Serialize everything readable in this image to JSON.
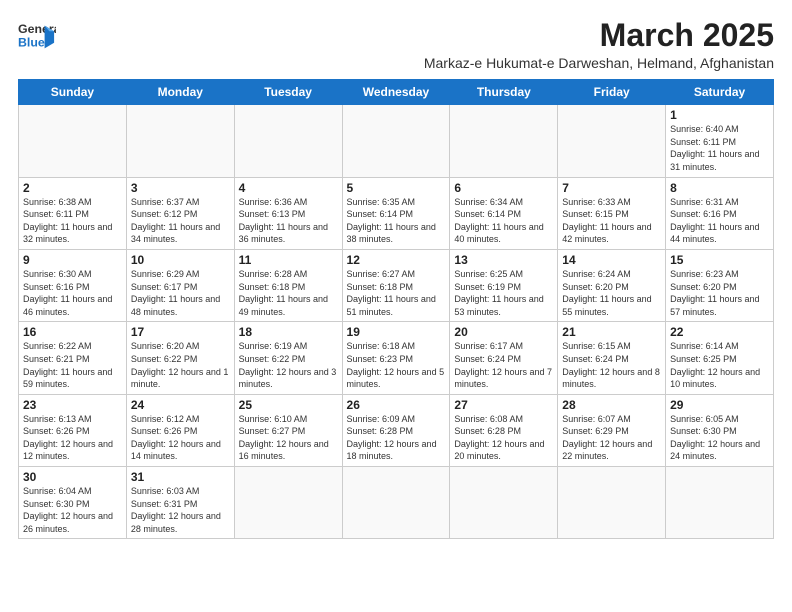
{
  "logo": {
    "line1": "General",
    "line2": "Blue"
  },
  "title": "March 2025",
  "subtitle": "Markaz-e Hukumat-e Darweshan, Helmand, Afghanistan",
  "weekdays": [
    "Sunday",
    "Monday",
    "Tuesday",
    "Wednesday",
    "Thursday",
    "Friday",
    "Saturday"
  ],
  "weeks": [
    [
      {
        "day": "",
        "info": ""
      },
      {
        "day": "",
        "info": ""
      },
      {
        "day": "",
        "info": ""
      },
      {
        "day": "",
        "info": ""
      },
      {
        "day": "",
        "info": ""
      },
      {
        "day": "",
        "info": ""
      },
      {
        "day": "1",
        "info": "Sunrise: 6:40 AM\nSunset: 6:11 PM\nDaylight: 11 hours and 31 minutes."
      }
    ],
    [
      {
        "day": "2",
        "info": "Sunrise: 6:38 AM\nSunset: 6:11 PM\nDaylight: 11 hours and 32 minutes."
      },
      {
        "day": "3",
        "info": "Sunrise: 6:37 AM\nSunset: 6:12 PM\nDaylight: 11 hours and 34 minutes."
      },
      {
        "day": "4",
        "info": "Sunrise: 6:36 AM\nSunset: 6:13 PM\nDaylight: 11 hours and 36 minutes."
      },
      {
        "day": "5",
        "info": "Sunrise: 6:35 AM\nSunset: 6:14 PM\nDaylight: 11 hours and 38 minutes."
      },
      {
        "day": "6",
        "info": "Sunrise: 6:34 AM\nSunset: 6:14 PM\nDaylight: 11 hours and 40 minutes."
      },
      {
        "day": "7",
        "info": "Sunrise: 6:33 AM\nSunset: 6:15 PM\nDaylight: 11 hours and 42 minutes."
      },
      {
        "day": "8",
        "info": "Sunrise: 6:31 AM\nSunset: 6:16 PM\nDaylight: 11 hours and 44 minutes."
      }
    ],
    [
      {
        "day": "9",
        "info": "Sunrise: 6:30 AM\nSunset: 6:16 PM\nDaylight: 11 hours and 46 minutes."
      },
      {
        "day": "10",
        "info": "Sunrise: 6:29 AM\nSunset: 6:17 PM\nDaylight: 11 hours and 48 minutes."
      },
      {
        "day": "11",
        "info": "Sunrise: 6:28 AM\nSunset: 6:18 PM\nDaylight: 11 hours and 49 minutes."
      },
      {
        "day": "12",
        "info": "Sunrise: 6:27 AM\nSunset: 6:18 PM\nDaylight: 11 hours and 51 minutes."
      },
      {
        "day": "13",
        "info": "Sunrise: 6:25 AM\nSunset: 6:19 PM\nDaylight: 11 hours and 53 minutes."
      },
      {
        "day": "14",
        "info": "Sunrise: 6:24 AM\nSunset: 6:20 PM\nDaylight: 11 hours and 55 minutes."
      },
      {
        "day": "15",
        "info": "Sunrise: 6:23 AM\nSunset: 6:20 PM\nDaylight: 11 hours and 57 minutes."
      }
    ],
    [
      {
        "day": "16",
        "info": "Sunrise: 6:22 AM\nSunset: 6:21 PM\nDaylight: 11 hours and 59 minutes."
      },
      {
        "day": "17",
        "info": "Sunrise: 6:20 AM\nSunset: 6:22 PM\nDaylight: 12 hours and 1 minute."
      },
      {
        "day": "18",
        "info": "Sunrise: 6:19 AM\nSunset: 6:22 PM\nDaylight: 12 hours and 3 minutes."
      },
      {
        "day": "19",
        "info": "Sunrise: 6:18 AM\nSunset: 6:23 PM\nDaylight: 12 hours and 5 minutes."
      },
      {
        "day": "20",
        "info": "Sunrise: 6:17 AM\nSunset: 6:24 PM\nDaylight: 12 hours and 7 minutes."
      },
      {
        "day": "21",
        "info": "Sunrise: 6:15 AM\nSunset: 6:24 PM\nDaylight: 12 hours and 8 minutes."
      },
      {
        "day": "22",
        "info": "Sunrise: 6:14 AM\nSunset: 6:25 PM\nDaylight: 12 hours and 10 minutes."
      }
    ],
    [
      {
        "day": "23",
        "info": "Sunrise: 6:13 AM\nSunset: 6:26 PM\nDaylight: 12 hours and 12 minutes."
      },
      {
        "day": "24",
        "info": "Sunrise: 6:12 AM\nSunset: 6:26 PM\nDaylight: 12 hours and 14 minutes."
      },
      {
        "day": "25",
        "info": "Sunrise: 6:10 AM\nSunset: 6:27 PM\nDaylight: 12 hours and 16 minutes."
      },
      {
        "day": "26",
        "info": "Sunrise: 6:09 AM\nSunset: 6:28 PM\nDaylight: 12 hours and 18 minutes."
      },
      {
        "day": "27",
        "info": "Sunrise: 6:08 AM\nSunset: 6:28 PM\nDaylight: 12 hours and 20 minutes."
      },
      {
        "day": "28",
        "info": "Sunrise: 6:07 AM\nSunset: 6:29 PM\nDaylight: 12 hours and 22 minutes."
      },
      {
        "day": "29",
        "info": "Sunrise: 6:05 AM\nSunset: 6:30 PM\nDaylight: 12 hours and 24 minutes."
      }
    ],
    [
      {
        "day": "30",
        "info": "Sunrise: 6:04 AM\nSunset: 6:30 PM\nDaylight: 12 hours and 26 minutes."
      },
      {
        "day": "31",
        "info": "Sunrise: 6:03 AM\nSunset: 6:31 PM\nDaylight: 12 hours and 28 minutes."
      },
      {
        "day": "",
        "info": ""
      },
      {
        "day": "",
        "info": ""
      },
      {
        "day": "",
        "info": ""
      },
      {
        "day": "",
        "info": ""
      },
      {
        "day": "",
        "info": ""
      }
    ]
  ]
}
